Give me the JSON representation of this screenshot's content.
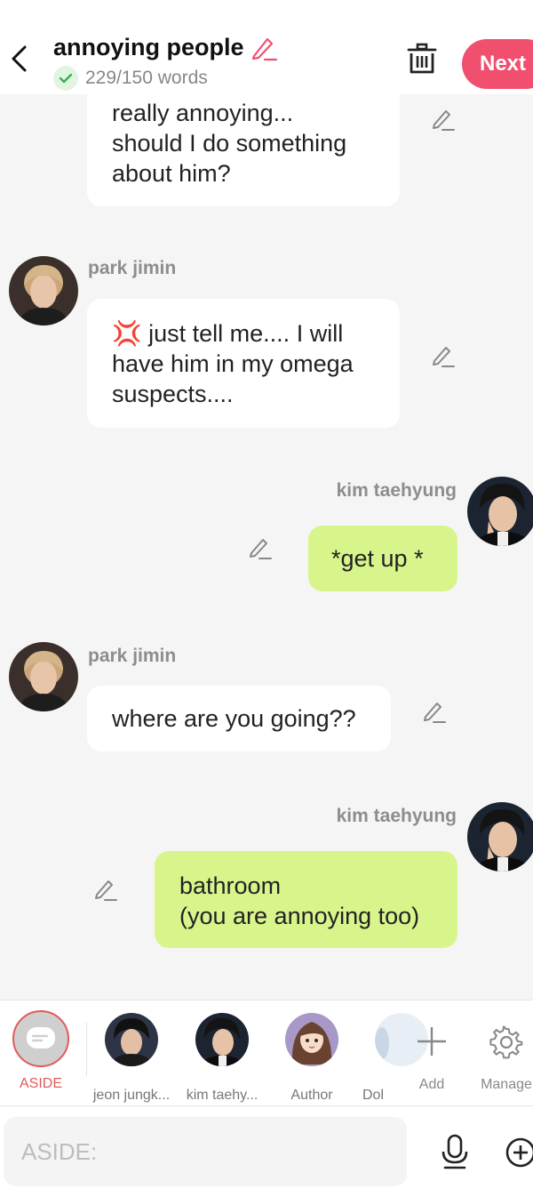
{
  "header": {
    "title": "annoying people",
    "word_count": "229/150 words",
    "next_label": "Next"
  },
  "messages": [
    {
      "side": "left",
      "sender": "",
      "lines": [
        "really annoying...",
        "should I do something",
        "about him?"
      ]
    },
    {
      "side": "left",
      "sender": "park jimin",
      "lines": [
        "just tell me.... I will",
        "have him in my omega",
        "suspects...."
      ],
      "emoji": "💢"
    },
    {
      "side": "right",
      "sender": "kim taehyung",
      "lines": [
        "*get up *"
      ]
    },
    {
      "side": "left",
      "sender": "park jimin",
      "lines": [
        "where are you going??"
      ]
    },
    {
      "side": "right",
      "sender": "kim taehyung",
      "lines": [
        "bathroom",
        "(you are annoying too)"
      ]
    }
  ],
  "characters": {
    "aside_label": "ASIDE",
    "items": [
      {
        "label": "jeon jungk..."
      },
      {
        "label": "kim taehy..."
      },
      {
        "label": "Author"
      },
      {
        "label": "Dol"
      }
    ],
    "add_label": "Add",
    "manage_label": "Manage"
  },
  "input": {
    "placeholder": "ASIDE:"
  },
  "colors": {
    "accent": "#f0506e",
    "right_bubble": "#d8f58c",
    "left_bubble": "#ffffff",
    "aside_red": "#e35a5a"
  }
}
